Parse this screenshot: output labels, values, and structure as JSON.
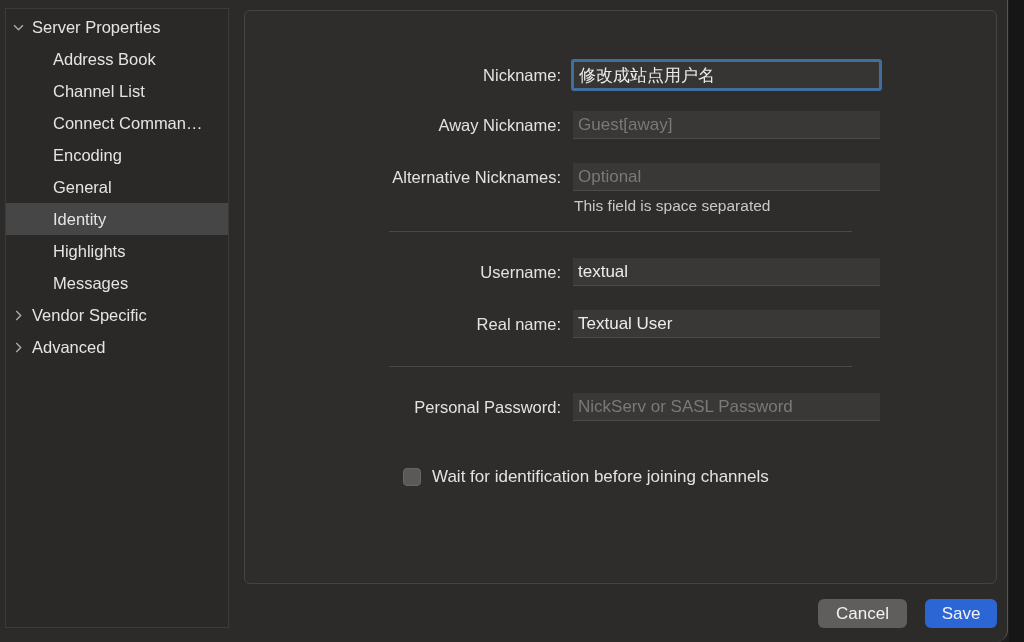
{
  "sidebar": {
    "items": [
      {
        "label": "Server Properties",
        "expanded": true,
        "selected": false,
        "children": [
          {
            "label": "Address Book",
            "selected": false
          },
          {
            "label": "Channel List",
            "selected": false
          },
          {
            "label": "Connect Comman…",
            "selected": false
          },
          {
            "label": "Encoding",
            "selected": false
          },
          {
            "label": "General",
            "selected": false
          },
          {
            "label": "Identity",
            "selected": true
          },
          {
            "label": "Highlights",
            "selected": false
          },
          {
            "label": "Messages",
            "selected": false
          }
        ]
      },
      {
        "label": "Vendor Specific",
        "expanded": false,
        "selected": false
      },
      {
        "label": "Advanced",
        "expanded": false,
        "selected": false
      }
    ]
  },
  "form": {
    "rows": [
      {
        "kind": "field",
        "label": "Nickname:",
        "value": "修改成站点用户名",
        "focused": true
      },
      {
        "kind": "field",
        "label": "Away Nickname:",
        "placeholder": "Guest[away]",
        "focused": false
      },
      {
        "kind": "field",
        "label": "Alternative Nicknames:",
        "placeholder": "Optional",
        "focused": false
      },
      {
        "kind": "hint",
        "text": "This field is space separated"
      },
      {
        "kind": "divider"
      },
      {
        "kind": "field",
        "label": "Username:",
        "value": "textual",
        "focused": false
      },
      {
        "kind": "field",
        "label": "Real name:",
        "value": "Textual User",
        "focused": false
      },
      {
        "kind": "divider"
      },
      {
        "kind": "field",
        "label": "Personal Password:",
        "placeholder": "NickServ or SASL Password",
        "focused": false
      },
      {
        "kind": "checkbox",
        "label": "Wait for identification before joining channels",
        "checked": false
      }
    ]
  },
  "buttons": [
    {
      "label": "Cancel",
      "kind": "secondary"
    },
    {
      "label": "Save",
      "kind": "primary"
    }
  ]
}
